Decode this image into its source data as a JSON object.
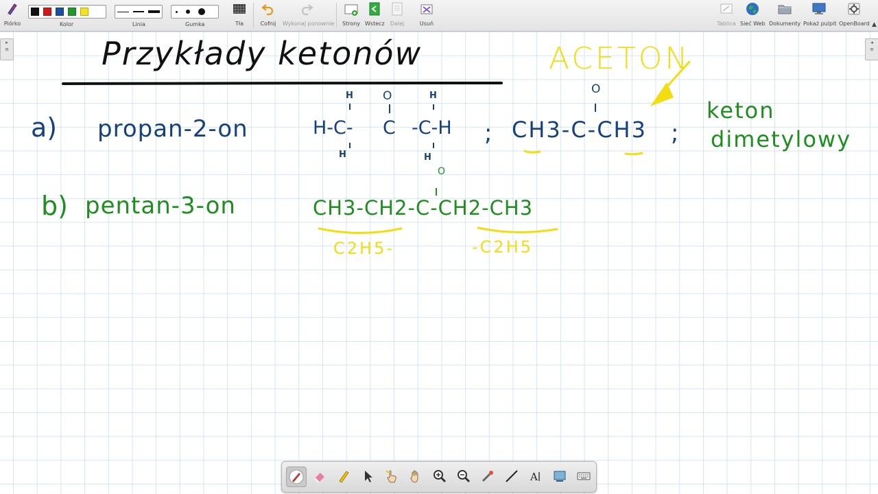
{
  "toolbar": {
    "pen": "Piórko",
    "color": "Kolor",
    "line": "Linia",
    "eraser": "Gumka",
    "background": "Tła",
    "undo": "Cofnij",
    "redo": "Wykonaj ponownie",
    "pages": "Strony",
    "back": "Wstecz",
    "next": "Dalej",
    "delete": "Usuń",
    "board": "Tablica",
    "web": "Sieć Web",
    "documents": "Dokumenty",
    "show_desktop": "Pokaż pulpit",
    "app": "OpenBoard"
  },
  "colors": {
    "palette": [
      "#111111",
      "#d01818",
      "#1a4fa3",
      "#1f9a2a",
      "#f2e31c"
    ],
    "ink_black": "#111111",
    "ink_blue": "#16417f",
    "ink_green": "#1e8f1e",
    "ink_yellow": "#f2dc12",
    "grid": "#8cbee1"
  },
  "board": {
    "title": "Przykłady ketonów",
    "acetone_label": "ACETON",
    "a": {
      "marker": "a)",
      "name": "propan-2-on",
      "structural_left": "H-C-",
      "structural_mid": "C",
      "structural_right": "-C-H",
      "h_top_left": "H",
      "o_top": "O",
      "h_top_right": "H",
      "h_bottom_left": "H",
      "h_bottom_right": "H",
      "separator": ";",
      "condensed": "CH3-C-CH3",
      "condensed_o": "O",
      "end": ";"
    },
    "b": {
      "marker": "b)",
      "name": "pentan-3-on",
      "formula": "CH3-CH2-C-CH2-CH3",
      "formula_o": "O",
      "ethyl_left": "C2H5-",
      "ethyl_right": "-C2H5"
    },
    "green_note_line1": "keton",
    "green_note_line2": "dimetylowy"
  },
  "bottom_tools": [
    "pen-icon",
    "eraser-icon",
    "highlighter-icon",
    "pointer-icon",
    "interact-icon",
    "hand-icon",
    "zoom-in-icon",
    "zoom-out-icon",
    "laser-pointer-icon",
    "line-icon",
    "text-icon",
    "capture-icon",
    "keyboard-icon"
  ]
}
